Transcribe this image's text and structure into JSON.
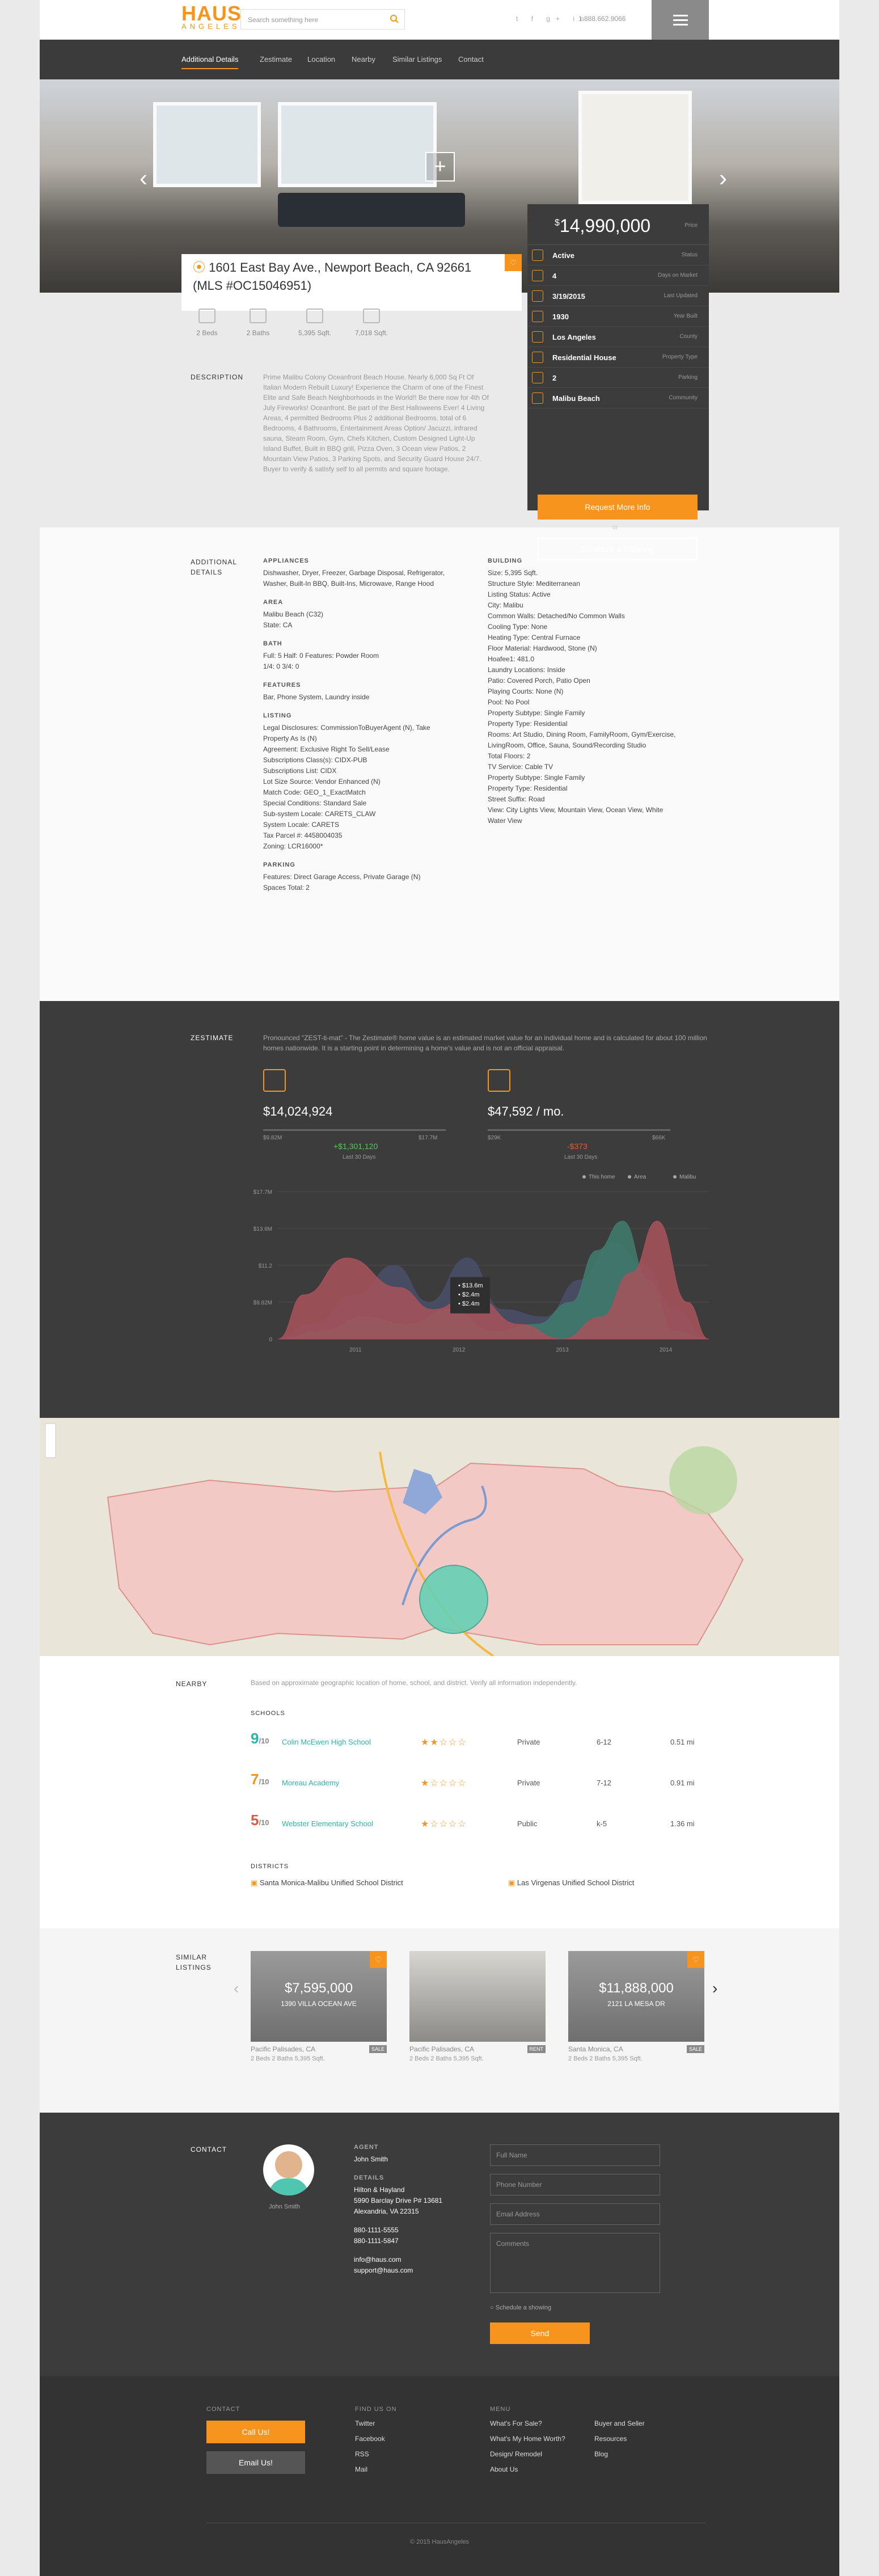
{
  "header": {
    "logo_main": "HAUS",
    "logo_sub": "ANGELES",
    "search_placeholder": "Search something here",
    "social": "t  f  g+  in",
    "phone": "1.888.662.9066"
  },
  "subnav": [
    "Additional Details",
    "Zestimate",
    "Location",
    "Nearby",
    "Similar Listings",
    "Contact"
  ],
  "listing": {
    "address": "1601 East Bay Ave., Newport Beach, CA 92661",
    "mls": "(MLS #OC15046951)",
    "price": "14,990,000",
    "price_label": "Price",
    "facts": [
      {
        "v": "Active",
        "k": "Status"
      },
      {
        "v": "4",
        "k": "Days on Market"
      },
      {
        "v": "3/19/2015",
        "k": "Last Updated"
      },
      {
        "v": "1930",
        "k": "Year Built"
      },
      {
        "v": "Los Angeles",
        "k": "County"
      },
      {
        "v": "Residential House",
        "k": "Property Type"
      },
      {
        "v": "2",
        "k": "Parking"
      },
      {
        "v": "Malibu Beach",
        "k": "Community"
      }
    ],
    "btn_more": "Request More Info",
    "or": "or",
    "btn_show": "Schedule a Showing",
    "stats": [
      "2 Beds",
      "2 Baths",
      "5,395 Sqft.",
      "7,018 Sqft."
    ],
    "desc_label": "DESCRIPTION",
    "desc": "Prime Malibu Colony Oceanfront Beach House. Nearly 6,000 Sq Ft Of Italian Modern Rebuilt Luxury! Experience the Charm of one of the Finest Elite and Safe Beach Neighborhoods in the World!! Be there now for 4th Of July Fireworks! Oceanfront. Be part of the Best Halloweens Ever! 4 Living Areas, 4 permitted Bedrooms Plus 2 additional Bedrooms. total of 6 Bedrooms, 4 Bathrooms, Entertainment Areas Option/ Jacuzzi, infrared sauna, Steam Room, Gym, Chefs Kitchen, Custom Designed Light-Up Island Buffet, Built in BBQ grill, Pizza Oven, 3 Ocean view Patios, 2 Mountain View Patios, 3 Parking Spots, and Security Guard House 24/7. Buyer to verify & satisfy self to all permits and square footage."
  },
  "details": {
    "label": "ADDITIONAL DETAILS",
    "left": [
      {
        "h": "APPLIANCES",
        "lines": [
          "Dishwasher, Dryer, Freezer, Garbage Disposal, Refrigerator,",
          "Washer, Built-In BBQ, Built-Ins, Microwave, Range Hood"
        ]
      },
      {
        "h": "AREA",
        "lines": [
          "Malibu Beach (C32)",
          "State: CA"
        ]
      },
      {
        "h": "BATH",
        "lines": [
          "Full: 5     Half: 0     Features: Powder Room",
          "1/4: 0     3/4: 0"
        ]
      },
      {
        "h": "FEATURES",
        "lines": [
          "Bar, Phone System, Laundry inside"
        ]
      },
      {
        "h": "LISTING",
        "lines": [
          "Legal Disclosures: CommissionToBuyerAgent (N), Take",
          "Property As Is (N)",
          "Agreement: Exclusive Right To Sell/Lease",
          "Subscriptions Class(s): CIDX-PUB",
          "Subscriptions List: CIDX",
          "Lot Size Source: Vendor Enhanced (N)",
          "Match Code: GEO_1_ExactMatch",
          "Special Conditions: Standard Sale",
          "Sub-system Locale: CARETS_CLAW",
          "System Locale: CARETS",
          "Tax Parcel #: 4458004035",
          "Zoning: LCR16000*"
        ]
      },
      {
        "h": "PARKING",
        "lines": [
          "Features: Direct Garage Access, Private Garage (N)",
          "Spaces Total: 2"
        ]
      }
    ],
    "right": [
      {
        "h": "BUILDING",
        "lines": [
          "Size: 5,395 Sqft.",
          "Structure Style: Mediterranean",
          "Listing Status: Active",
          "City: Malibu",
          "Common Walls: Detached/No Common Walls",
          "Cooling Type: None",
          "Heating Type: Central Furnace",
          "Floor Material: Hardwood, Stone (N)",
          "Hoafee1: 481.0",
          "Laundry Locations: Inside",
          "Patio: Covered Porch, Patio Open",
          "Playing Courts: None (N)",
          "Pool: No Pool",
          "Property Subtype: Single Family",
          "Property Type: Residential",
          "Rooms: Art Studio, Dining Room, FamilyRoom, Gym/Exercise,",
          "LivingRoom, Office, Sauna, Sound/Recording Studio",
          "Total Floors: 2",
          "TV Service: Cable TV",
          "Property Subtype: Single Family",
          "Property Type: Residential",
          "Street Suffix: Road",
          "View: City Lights View, Mountain View, Ocean View, White",
          "Water View"
        ]
      }
    ]
  },
  "zestimate": {
    "label": "ZESTIMATE",
    "desc": "Pronounced \"ZEST-ti-mat\" - The Zestimate® home value is an estimated market value for an individual home and is calculated for about 100 million homes nationwide. It is a starting point in determining a home's value and is not an official appraisal.",
    "sale": {
      "value": "$14,024,924",
      "lo": "$9.82M",
      "hi": "$17.7M",
      "chg": "+$1,301,120",
      "chg_label": "Last 30 Days"
    },
    "rent": {
      "value": "$47,592 / mo.",
      "lo": "$29K",
      "hi": "$66K",
      "chg": "-$373",
      "chg_label": "Last 30 Days"
    },
    "legend": [
      "This home",
      "Area",
      "Malibu"
    ],
    "tooltip": [
      "$13.6m",
      "$2.4m",
      "$2.4m"
    ]
  },
  "chart_data": {
    "type": "area",
    "title": "",
    "x": [
      2011,
      2012,
      2013,
      2014
    ],
    "yticks": [
      "$17.7M",
      "$13.6M",
      "$11.2",
      "$9.82M",
      "0"
    ],
    "series": [
      {
        "name": "This home",
        "color": "#a8525a"
      },
      {
        "name": "Area",
        "color": "#4a4f6a"
      },
      {
        "name": "Malibu",
        "color": "#3f7d6d"
      }
    ]
  },
  "nearby": {
    "label": "NEARBY",
    "note": "Based on approximate geographic location of home, school, and district. Verify all information independently.",
    "schools_h": "SCHOOLS",
    "schools": [
      {
        "score": "9",
        "name": "Colin McEwen High School",
        "stars": "★★☆☆☆",
        "type": "Private",
        "grades": "6-12",
        "dist": "0.51 mi",
        "color": "#2bb5a9"
      },
      {
        "score": "7",
        "name": "Moreau Academy",
        "stars": "★☆☆☆☆",
        "type": "Private",
        "grades": "7-12",
        "dist": "0.91 mi",
        "color": "#f7941d"
      },
      {
        "score": "5",
        "name": "Webster Elementary School",
        "stars": "★☆☆☆☆",
        "type": "Public",
        "grades": "k-5",
        "dist": "1.36 mi",
        "color": "#e05a3f"
      }
    ],
    "districts_h": "DISTRICTS",
    "districts": [
      "Santa Monica-Malibu Unified School District",
      "Las Virgenas Unified School District"
    ]
  },
  "similar": {
    "label": "SIMILAR LISTINGS",
    "cards": [
      {
        "price": "$7,595,000",
        "addr": "1390 VILLA OCEAN AVE",
        "loc": "Pacific Palisades, CA",
        "tag": "SALE"
      },
      {
        "price": "",
        "addr": "",
        "loc": "Pacific Palisades, CA",
        "tag": "RENT"
      },
      {
        "price": "$11,888,000",
        "addr": "2121 LA MESA DR",
        "loc": "Santa Monica, CA",
        "tag": "SALE"
      }
    ],
    "card_stats": "2 Beds   2 Baths   5,395 Sqft."
  },
  "contact": {
    "label": "CONTACT",
    "agent_h": "AGENT",
    "agent": "John Smith",
    "details_h": "DETAILS",
    "company": "Hilton & Hayland",
    "addr1": "5990 Barclay Drive P# 13681",
    "addr2": "Alexandria, VA 22315",
    "ph1": "880-1111-5555",
    "ph2": "880-1111-5847",
    "em1": "info@haus.com",
    "em2": "support@haus.com",
    "f1": "Full Name",
    "f2": "Phone Number",
    "f3": "Email Address",
    "f4": "Comments",
    "check": "Schedule a showing",
    "send": "Send"
  },
  "footer": {
    "contact_h": "CONTACT",
    "call": "Call Us!",
    "email": "Email Us!",
    "find_h": "FIND US ON",
    "find": [
      "Twitter",
      "Facebook",
      "RSS",
      "Mail"
    ],
    "menu_h": "MENU",
    "menu1": [
      "What's For Sale?",
      "What's My Home Worth?",
      "Design/ Remodel",
      "About Us"
    ],
    "menu2": [
      "Buyer and Seller",
      "Resources",
      "Blog"
    ],
    "copy": "© 2015 HausAngeles"
  }
}
